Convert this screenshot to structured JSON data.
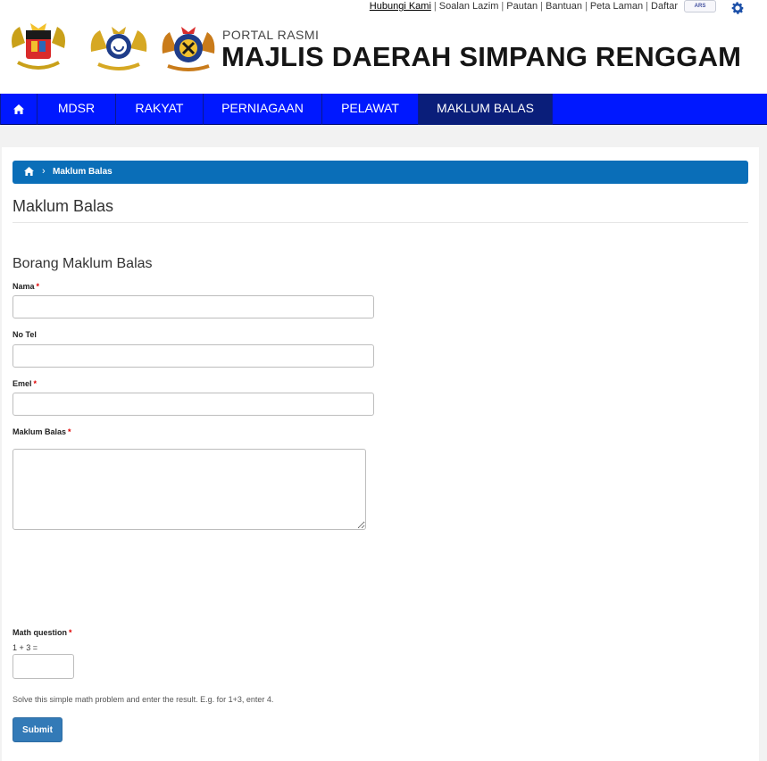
{
  "top_links": [
    "Hubungi Kami",
    "Soalan Lazim",
    "Pautan",
    "Bantuan",
    "Peta Laman",
    "Daftar"
  ],
  "header": {
    "portal_label": "PORTAL RASMI",
    "site_title": "MAJLIS DAERAH SIMPANG RENGGAM",
    "logos": [
      "malaysia-coat-of-arms",
      "johor-coat-of-arms",
      "mdsr-crest"
    ]
  },
  "nav": {
    "items": [
      "MDSR",
      "RAKYAT",
      "PERNIAGAAN",
      "PELAWAT",
      "MAKLUM BALAS"
    ],
    "active": "MAKLUM BALAS"
  },
  "breadcrumb": {
    "current": "Maklum Balas"
  },
  "page": {
    "title": "Maklum Balas"
  },
  "form": {
    "title": "Borang Maklum Balas",
    "nama_label": "Nama",
    "notel_label": "No Tel",
    "emel_label": "Emel",
    "maklum_balas_label": "Maklum Balas",
    "required_mark": "*",
    "math_label": "Math question",
    "math_question": "1 + 3 =",
    "math_help": "Solve this simple math problem and enter the result. E.g. for 1+3, enter 4.",
    "submit_label": "Submit"
  },
  "colors": {
    "nav_bg": "#0018ff",
    "nav_active": "#0a1e7a",
    "breadcrumb_bg": "#0a6eb8",
    "button_bg": "#337ab7"
  }
}
